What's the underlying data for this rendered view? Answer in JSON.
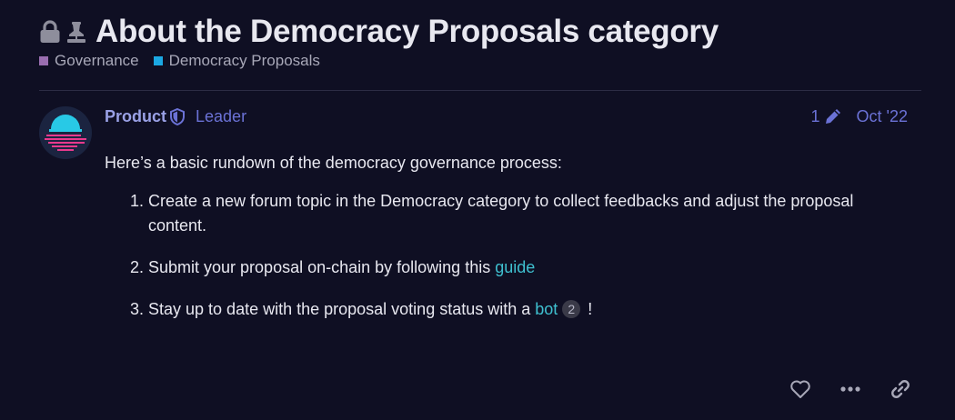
{
  "topic": {
    "title": "About the Democracy Proposals category",
    "icons": [
      "lock-icon",
      "pin-icon"
    ]
  },
  "categories": [
    {
      "name": "Governance",
      "color": "#9a6eb0"
    },
    {
      "name": "Democracy Proposals",
      "color": "#1ba8e3"
    }
  ],
  "post": {
    "username": "Product",
    "user_title": "Leader",
    "edit_count": "1",
    "date": "Oct '22",
    "intro": "Here’s a basic rundown of the democracy governance process:",
    "steps": [
      {
        "text": "Create a new forum topic in the Democracy category to collect feedbacks and adjust the proposal content."
      },
      {
        "text_before": "Submit your proposal on-chain by following this ",
        "link": "guide"
      },
      {
        "text_before": "Stay up to date with the proposal voting status with a ",
        "link": "bot",
        "clicks": "2",
        "text_after": " !"
      }
    ]
  },
  "actions": [
    "like-icon",
    "more-icon",
    "link-icon"
  ],
  "colors": {
    "background": "#0f0f23",
    "username": "#9aa1e6",
    "accent": "#6b72d6",
    "link": "#3fc0d0"
  }
}
